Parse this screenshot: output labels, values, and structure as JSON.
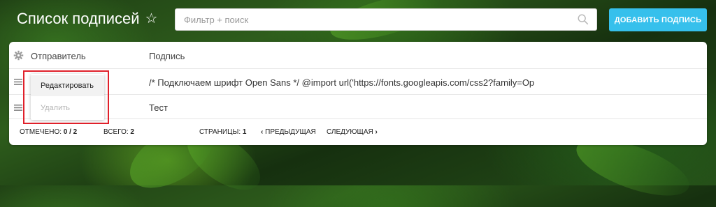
{
  "header": {
    "title": "Список подписей",
    "favorite_icon": "star-outline-icon",
    "search_placeholder": "Фильтр + поиск",
    "search_icon": "search-icon",
    "add_button_label": "ДОБАВИТЬ ПОДПИСЬ",
    "add_button_color": "#36c0ec"
  },
  "table": {
    "settings_icon": "gear-icon",
    "columns": [
      "Отправитель",
      "Подпись"
    ],
    "rows": [
      {
        "sender": "",
        "signature": "/* Подключаем шрифт Open Sans */ @import url('https://fonts.googleapis.com/css2?family=Op"
      },
      {
        "sender": "",
        "signature": "Тест"
      }
    ]
  },
  "context_menu": {
    "items": [
      {
        "label": "Редактировать",
        "enabled": true
      },
      {
        "label": "Удалить",
        "enabled": false
      }
    ],
    "highlight_color": "#e0202a"
  },
  "footer": {
    "selected_label": "ОТМЕЧЕНО:",
    "selected_value": "0 / 2",
    "total_label": "ВСЕГО:",
    "total_value": "2",
    "pages_label": "СТРАНИЦЫ:",
    "pages_value": "1",
    "prev_label": "ПРЕДЫДУЩАЯ",
    "next_label": "СЛЕДУЮЩАЯ"
  }
}
